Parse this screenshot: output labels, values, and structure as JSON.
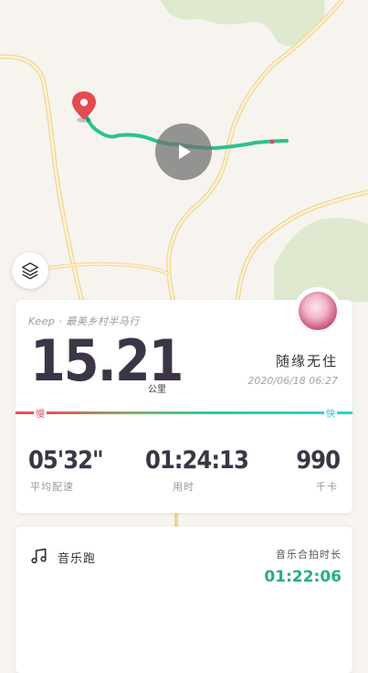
{
  "map": {
    "route_color": "#2cc38a",
    "pin_color": "#e44a4f"
  },
  "activity": {
    "title": "Keep · 最美乡村半马行",
    "distance": "15.21",
    "distance_unit": "公里",
    "username": "随缘无住",
    "datetime": "2020/06/18 06:27",
    "pace_slow_label": "慢",
    "pace_fast_label": "快"
  },
  "stats": [
    {
      "value": "05'32\"",
      "label": "平均配速"
    },
    {
      "value": "01:24:13",
      "label": "用时"
    },
    {
      "value": "990",
      "label": "千卡"
    }
  ],
  "music": {
    "title": "音乐跑",
    "duration_label": "音乐合拍时长",
    "duration_value": "01:22:06",
    "accent": "#22b07b"
  }
}
